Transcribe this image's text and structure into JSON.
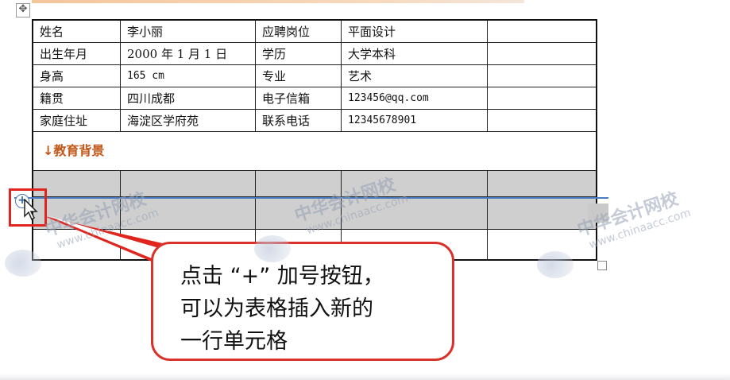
{
  "table": {
    "rows": [
      [
        "姓名",
        "李小丽",
        "应聘岗位",
        "平面设计"
      ],
      [
        "出生年月",
        "2000 年 1 月 1 日",
        "学历",
        "大学本科"
      ],
      [
        "身高",
        "165 cm",
        "专业",
        "艺术"
      ],
      [
        "籍贯",
        "四川成都",
        "电子信箱",
        "123456@qq.com"
      ],
      [
        "家庭住址",
        "海淀区学府苑",
        "联系电话",
        "12345678901"
      ]
    ],
    "section_heading": "↓教育背景"
  },
  "insert_button": {
    "symbol": "+"
  },
  "callout": {
    "lines": [
      "点击 “+” 加号按钮，",
      "可以为表格插入新的",
      "一行单元格"
    ]
  },
  "watermark": {
    "name": "中华会计网校",
    "url": "www.chinaacc.com"
  },
  "colors": {
    "highlight": "#e0251e",
    "heading": "#c2571a",
    "guide_line": "#4a7cc2"
  }
}
